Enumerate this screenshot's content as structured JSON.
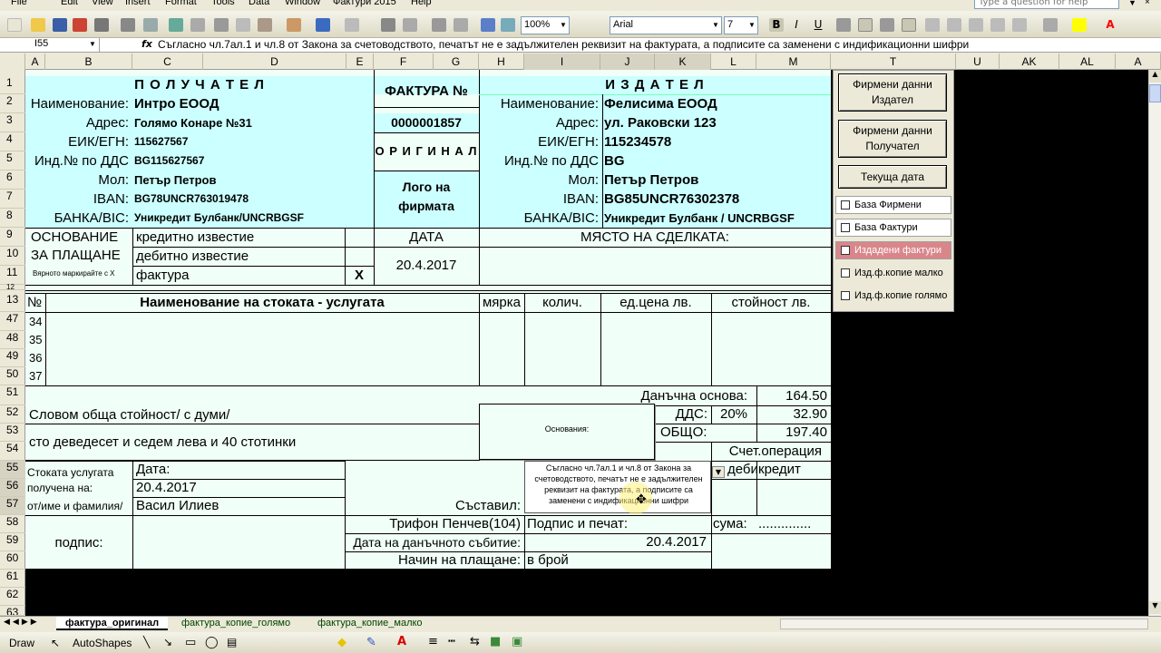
{
  "menu": {
    "items": [
      "File",
      "Edit",
      "View",
      "Insert",
      "Format",
      "Tools",
      "Data",
      "Window",
      "Фактури 2015",
      "Help"
    ],
    "help_placeholder": "Type a question for help"
  },
  "toolbar": {
    "zoom": "100%",
    "font": "Arial",
    "font_size": "7"
  },
  "formula_bar": {
    "cell_ref": "I55",
    "fx": "fx",
    "content": "Съгласно чл.7ал.1 и чл.8 от Закона за счетоводството, печатът не е задължителен реквизит на фактурата, а подписите са заменени с индификационни шифри"
  },
  "columns": [
    "A",
    "B",
    "C",
    "D",
    "E",
    "F",
    "G",
    "H",
    "I",
    "J",
    "K",
    "L",
    "M",
    "T",
    "U",
    "AK",
    "AL",
    "A"
  ],
  "rows": [
    "1",
    "2",
    "3",
    "4",
    "5",
    "6",
    "7",
    "8",
    "9",
    "10",
    "11",
    "12",
    "13",
    "47",
    "48",
    "49",
    "50",
    "51",
    "52",
    "53",
    "54",
    "55",
    "56",
    "57",
    "58",
    "59",
    "60",
    "61",
    "62",
    "63"
  ],
  "recipient": {
    "title": "П О Л У Ч А Т Е Л",
    "labels": [
      "Наименование:",
      "Адрес:",
      "ЕИК/ЕГН:",
      "Инд.№ по ДДС",
      "Мол:",
      "IBAN:",
      "БАНКА/BIC:"
    ],
    "values": [
      "Интро ЕООД",
      "Голямо Конаре №31",
      "115627567",
      "BG115627567",
      "Петър Петров",
      "BG78UNCR763019478",
      "Уникредит Булбанк/UNCRBGSF"
    ]
  },
  "invoice": {
    "title": "ФАКТУРА №",
    "number": "0000001857",
    "original": "О Р И Г И Н А Л",
    "logo": "Лого на фирмата",
    "date_label": "ДАТА",
    "date": "20.4.2017",
    "place_label": "МЯСТО НА СДЕЛКАТА:"
  },
  "issuer": {
    "title": "И З Д А Т Е Л",
    "labels": [
      "Наименование:",
      "Адрес:",
      "ЕИК/ЕГН:",
      "Инд.№ по ДДС",
      "Мол:",
      "IBAN:",
      "БАНКА/BIC:"
    ],
    "values": [
      "Фелисима ЕООД",
      "ул. Раковски 123",
      "115234578",
      "BG",
      "Петър Петров",
      "BG85UNCR76302378",
      "Уникредит Булбанк / UNCRBGSF"
    ]
  },
  "basis": {
    "label1": "ОСНОВАНИЕ",
    "label2": "ЗА ПЛАЩАНЕ",
    "hint": "Вярното маркирайте с X",
    "options": [
      "кредитно известие",
      "дебитно известие",
      "фактура"
    ],
    "mark": "X"
  },
  "items_header": {
    "no": "№",
    "name": "Наименование на стоката - услугата",
    "unit": "мярка",
    "qty": "колич.",
    "price": "ед.цена лв.",
    "value": "стойност лв."
  },
  "item_numbers": [
    "34",
    "35",
    "36",
    "37"
  ],
  "totals": {
    "tax_base_label": "Данъчна основа:",
    "tax_base": "164.50",
    "vat_label": "ДДС:",
    "vat_rate": "20%",
    "vat": "32.90",
    "total_label": "ОБЩО:",
    "total": "197.40",
    "account_op": "Счет.операция",
    "debit": "дебит",
    "credit": "кредит",
    "sum_label": "сума:",
    "sum_value": ".............."
  },
  "words": {
    "label": "Словом обща стойност/ с думи/",
    "text": "сто деведесет и седем лева и 40 стотинки"
  },
  "grounds": {
    "label": "Основания:",
    "note": "Съгласно чл.7ал.1 и чл.8 от Закона за счетоводството, печатът не е задължителен реквизит на фактурата, а подписите са заменени с индификационни шифри"
  },
  "receipt": {
    "l1": "Стоката услугата",
    "l2": "получена на:",
    "l3": "от/име и фамилия/",
    "date_label": "Дата:",
    "date": "20.4.2017",
    "name": "Васил Илиев",
    "composed_label": "Съставил:",
    "composer": "Трифон Пенчев(104)",
    "sign_stamp": "Подпис и печат:",
    "sign": "подпис:",
    "tax_event_label": "Дата на данъчното събитие:",
    "tax_event": "20.4.2017",
    "pay_label": "Начин на плащане:",
    "pay": "в брой"
  },
  "side_panel": {
    "buttons": [
      "Фирмени данни Издател",
      "Фирмени данни Получател",
      "Текуща дата"
    ],
    "checks": [
      "База Фирмени данни",
      "База Фактури",
      "Издадени фактури",
      "Изд.ф.копие малко",
      "Изд.ф.копие голямо"
    ],
    "highlight_color": "#d9868a"
  },
  "sheet_tabs": [
    "фактура_оригинал",
    "фактура_копие_голямо",
    "фактура_копие_малко"
  ],
  "draw_toolbar": {
    "draw": "Draw",
    "autoshapes": "AutoShapes"
  }
}
